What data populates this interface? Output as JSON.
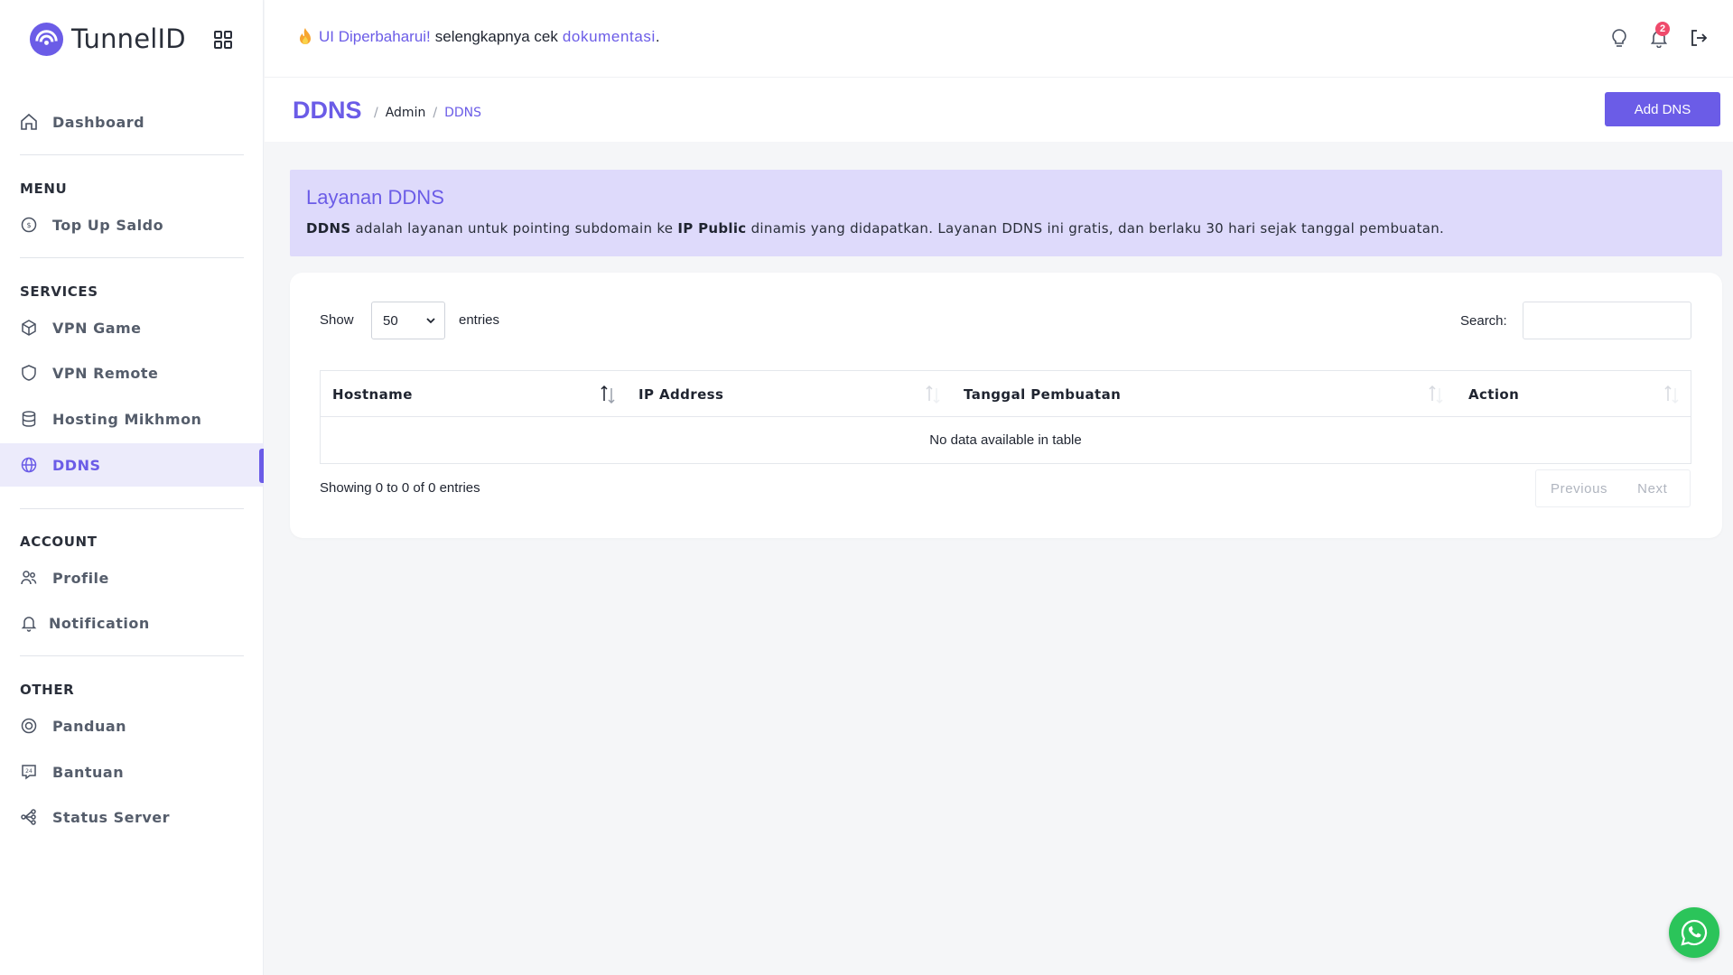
{
  "brand": {
    "name": "TunnelID"
  },
  "topbar": {
    "announce_highlight": "UI Diperbaharui!",
    "announce_text": "selengkapnya cek",
    "announce_link": "dokumentasi",
    "announce_end": ".",
    "notification_count": "2"
  },
  "sidebar": {
    "dashboard": "Dashboard",
    "sections": {
      "menu": "MENU",
      "services": "SERVICES",
      "account": "ACCOUNT",
      "other": "OTHER"
    },
    "items": {
      "topup": "Top Up Saldo",
      "vpn_game": "VPN Game",
      "vpn_remote": "VPN Remote",
      "hosting": "Hosting Mikhmon",
      "ddns": "DDNS",
      "profile": "Profile",
      "notification": "Notification",
      "panduan": "Panduan",
      "bantuan": "Bantuan",
      "status": "Status Server"
    },
    "active": "DDNS"
  },
  "page": {
    "title": "DDNS",
    "breadcrumb": [
      "Admin",
      "DDNS"
    ],
    "add_button": "Add DNS"
  },
  "info": {
    "title": "Layanan DDNS",
    "desc_b1": "DDNS",
    "desc_t1": "adalah layanan untuk pointing subdomain ke",
    "desc_b2": "IP Public",
    "desc_t2": "dinamis yang didapatkan. Layanan DDNS ini gratis, dan berlaku 30 hari sejak tanggal pembuatan."
  },
  "table": {
    "show_label": "Show",
    "page_size": "50",
    "entries_label": "entries",
    "search_label": "Search:",
    "search_value": "",
    "columns": [
      "Hostname",
      "IP Address",
      "Tanggal Pembuatan",
      "Action"
    ],
    "empty_text": "No data available in table",
    "info_text": "Showing 0 to 0 of 0 entries",
    "prev_label": "Previous",
    "next_label": "Next"
  },
  "colors": {
    "accent": "#6b5ce7",
    "info_bg": "#dedafb",
    "whatsapp": "#2bc45a",
    "badge": "#ef4a6b"
  }
}
